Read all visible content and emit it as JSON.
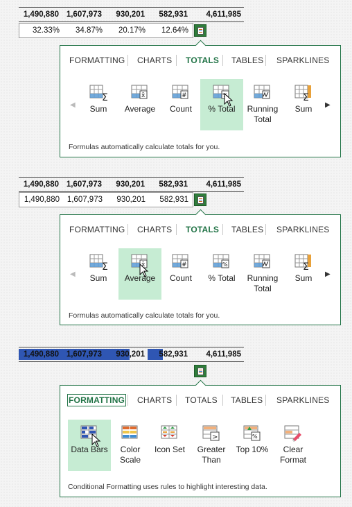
{
  "colors": {
    "accent": "#217346",
    "highlight": "#c6ecd3",
    "databar_blue": "#2f56b3"
  },
  "section1": {
    "row1": [
      "1,490,880",
      "1,607,973",
      "930,201",
      "582,931",
      "4,611,985"
    ],
    "row2": [
      "32.33%",
      "34.87%",
      "20.17%",
      "12.64%"
    ],
    "tabs": [
      "FORMATTING",
      "CHARTS",
      "TOTALS",
      "TABLES",
      "SPARKLINES"
    ],
    "active_tab": "TOTALS",
    "tools": [
      {
        "label": "Sum",
        "icon": "sum-icon"
      },
      {
        "label": "Average",
        "icon": "average-icon"
      },
      {
        "label": "Count",
        "icon": "count-icon"
      },
      {
        "label": "% Total",
        "icon": "percent-total-icon"
      },
      {
        "label": "Running Total",
        "icon": "running-total-icon"
      },
      {
        "label": "Sum",
        "icon": "sum-column-icon"
      }
    ],
    "highlighted_tool": "% Total",
    "description": "Formulas automatically calculate totals for you."
  },
  "section2": {
    "row1": [
      "1,490,880",
      "1,607,973",
      "930,201",
      "582,931",
      "4,611,985"
    ],
    "row2": [
      "1,490,880",
      "1,607,973",
      "930,201",
      "582,931"
    ],
    "tabs": [
      "FORMATTING",
      "CHARTS",
      "TOTALS",
      "TABLES",
      "SPARKLINES"
    ],
    "active_tab": "TOTALS",
    "tools": [
      {
        "label": "Sum",
        "icon": "sum-icon"
      },
      {
        "label": "Average",
        "icon": "average-icon"
      },
      {
        "label": "Count",
        "icon": "count-icon"
      },
      {
        "label": "% Total",
        "icon": "percent-total-icon"
      },
      {
        "label": "Running Total",
        "icon": "running-total-icon"
      },
      {
        "label": "Sum",
        "icon": "sum-column-icon"
      }
    ],
    "highlighted_tool": "Average",
    "description": "Formulas automatically calculate totals for you."
  },
  "section3": {
    "row1": [
      "1,490,880",
      "1,607,973",
      "930,201",
      "582,931",
      "4,611,985"
    ],
    "databar_fill": [
      1.0,
      1.0,
      0.58,
      0.36
    ],
    "tabs": [
      "FORMATTING",
      "CHARTS",
      "TOTALS",
      "TABLES",
      "SPARKLINES"
    ],
    "active_tab": "FORMATTING",
    "tools": [
      {
        "label": "Data Bars",
        "icon": "data-bars-icon"
      },
      {
        "label": "Color Scale",
        "icon": "color-scale-icon"
      },
      {
        "label": "Icon Set",
        "icon": "icon-set-icon"
      },
      {
        "label": "Greater Than",
        "icon": "greater-than-icon"
      },
      {
        "label": "Top 10%",
        "icon": "top-10-icon"
      },
      {
        "label": "Clear Format",
        "icon": "clear-format-icon"
      }
    ],
    "highlighted_tool": "Data Bars",
    "description": "Conditional Formatting uses rules to highlight interesting data."
  }
}
